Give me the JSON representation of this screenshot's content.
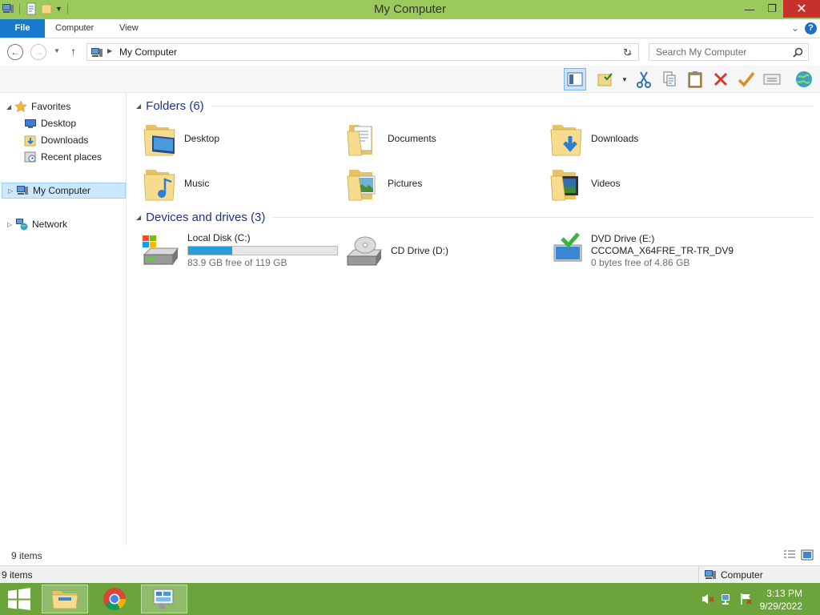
{
  "window": {
    "title": "My Computer"
  },
  "ribbon": {
    "tabs": [
      {
        "label": "File"
      },
      {
        "label": "Computer"
      },
      {
        "label": "View"
      }
    ],
    "help": "?"
  },
  "address": {
    "path": "My Computer"
  },
  "search": {
    "placeholder": "Search My Computer"
  },
  "nav": {
    "favorites": "Favorites",
    "items": [
      {
        "label": "Desktop"
      },
      {
        "label": "Downloads"
      },
      {
        "label": "Recent places"
      }
    ],
    "my_computer": "My Computer",
    "network": "Network"
  },
  "folders": {
    "header": "Folders (6)",
    "items": [
      {
        "label": "Desktop",
        "icon": "desktop-folder-icon"
      },
      {
        "label": "Documents",
        "icon": "documents-folder-icon"
      },
      {
        "label": "Downloads",
        "icon": "downloads-folder-icon"
      },
      {
        "label": "Music",
        "icon": "music-folder-icon"
      },
      {
        "label": "Pictures",
        "icon": "pictures-folder-icon"
      },
      {
        "label": "Videos",
        "icon": "videos-folder-icon"
      }
    ]
  },
  "drives": {
    "header": "Devices and drives (3)",
    "items": [
      {
        "name": "Local Disk (C:)",
        "free": "83.9 GB free of 119 GB",
        "used_fraction": 0.295
      },
      {
        "name": "CD Drive (D:)"
      },
      {
        "name": "DVD Drive (E:)",
        "label": "CCCOMA_X64FRE_TR-TR_DV9",
        "free": "0 bytes free of 4.86 GB"
      }
    ]
  },
  "status": {
    "items": "9 items",
    "items2": "9 items",
    "zone": "Computer"
  },
  "taskbar": {
    "time": "3:13 PM",
    "date": "9/29/2022"
  },
  "colors": {
    "title_bar": "#9bc95b",
    "file_tab": "#1979ca",
    "taskbar": "#6ba43a",
    "drive_bar": "#26a0da",
    "close": "#c7302b"
  }
}
